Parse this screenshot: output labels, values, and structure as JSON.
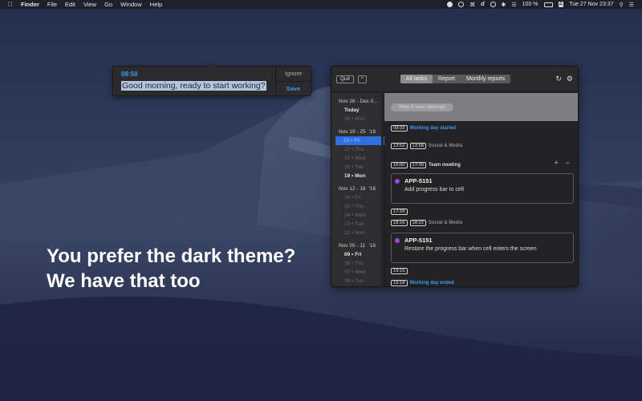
{
  "menubar": {
    "apple_icon": "apple-icon",
    "app_name": "Finder",
    "menus": [
      "File",
      "Edit",
      "View",
      "Go",
      "Window",
      "Help"
    ],
    "battery": "100 %",
    "input_source": "A",
    "clock": "Tue 27 Nov  23:37"
  },
  "promo": {
    "line1": "You prefer the dark theme?",
    "line2": "We have that too"
  },
  "notification": {
    "time": "08:50",
    "message": "Good morning, ready to start working?",
    "ignore_label": "Ignore",
    "save_label": "Save"
  },
  "app": {
    "quit_label": "Quit",
    "up_label": "^",
    "tabs": [
      "All tasks",
      "Report",
      "Monthly reports"
    ],
    "active_tab": "All tasks",
    "sidebar": {
      "groups": [
        {
          "range": "Nov 26 - Dec 0…",
          "year": "",
          "days": [
            {
              "label": "Today",
              "style": "bold"
            },
            {
              "label": "26 • Mon",
              "style": "dim"
            }
          ]
        },
        {
          "range": "Nov 19 - 25",
          "year": "'18",
          "days": [
            {
              "label": "23 • Fri",
              "style": "selected"
            },
            {
              "label": "22 • Thu",
              "style": "dim"
            },
            {
              "label": "21 • Wed",
              "style": "dim"
            },
            {
              "label": "20 • Tue",
              "style": "dim"
            },
            {
              "label": "19 • Mon",
              "style": "bold"
            }
          ]
        },
        {
          "range": "Nov 12 - 18",
          "year": "'18",
          "days": [
            {
              "label": "16 • Fri",
              "style": "dim"
            },
            {
              "label": "15 • Thu",
              "style": "dim"
            },
            {
              "label": "14 • Wed",
              "style": "dim"
            },
            {
              "label": "13 • Tue",
              "style": "dim"
            },
            {
              "label": "12 • Mon",
              "style": "dim"
            }
          ]
        },
        {
          "range": "Nov 05 - 11",
          "year": "'18",
          "days": [
            {
              "label": "09 • Fri",
              "style": "bold"
            },
            {
              "label": "08 • Thu",
              "style": "dim"
            },
            {
              "label": "07 • Wed",
              "style": "dim"
            },
            {
              "label": "06 • Tue",
              "style": "dim"
            }
          ]
        }
      ]
    },
    "view_save_label": "View & save worklogs",
    "entries": {
      "e1": {
        "time": "09:33",
        "label": "Working day started"
      },
      "e2": {
        "start": "13:52",
        "end": "13:58",
        "label": "Social & Media"
      },
      "e3": {
        "start": "16:00",
        "end": "17:00",
        "label": "Team meeting"
      },
      "card1": {
        "code": "APP-5151",
        "desc": "Add progress bar to cell"
      },
      "e4": {
        "time": "17:29"
      },
      "e5": {
        "start": "18:16",
        "end": "18:22",
        "label": "Social & Media"
      },
      "card2": {
        "code": "APP-5151",
        "desc": "Restore the progress bar when cell enters the screen"
      },
      "e6": {
        "time": "19:16"
      },
      "e7": {
        "time": "19:18",
        "label": "Working day ended"
      }
    },
    "plus": "+",
    "minus": "−"
  }
}
